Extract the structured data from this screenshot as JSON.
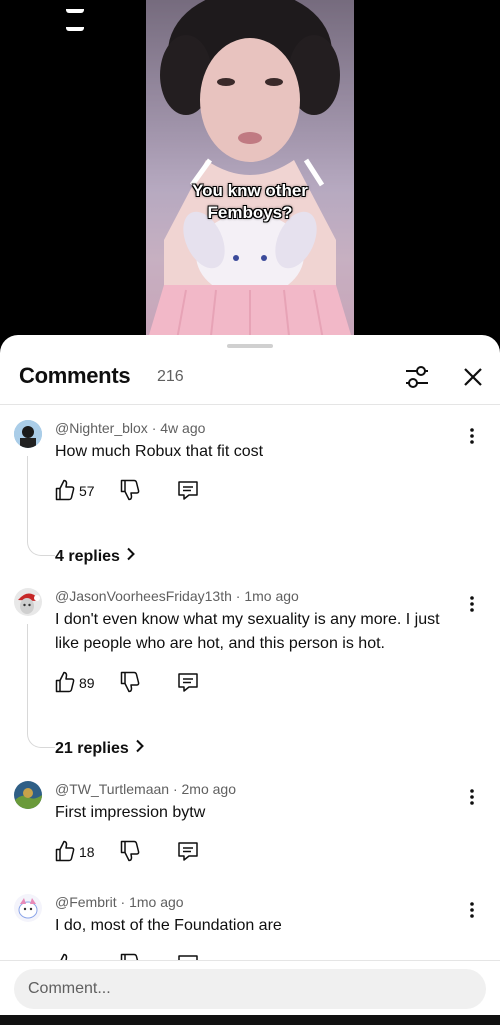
{
  "video": {
    "caption_line1": "You knw other",
    "caption_line2": "Femboys?"
  },
  "comments_sheet": {
    "title": "Comments",
    "count": "216",
    "filter_icon": "sliders-icon",
    "close_icon": "close-icon"
  },
  "comments": [
    {
      "author": "@Nighter_blox",
      "age": "4w ago",
      "meta": "@Nighter_blox · 4w ago",
      "text": "How much Robux that fit cost",
      "likes": "57",
      "replies": "4 replies"
    },
    {
      "author": "@JasonVoorheesFriday13th",
      "age": "1mo ago",
      "meta": "@JasonVoorheesFriday13th · 1mo ago",
      "text": "I don't even know what my sexuality is any more. I just like people who are hot, and this person is hot.",
      "likes": "89",
      "replies": "21 replies"
    },
    {
      "author": "@TW_Turtlemaan",
      "age": "2mo ago",
      "meta": "@TW_Turtlemaan · 2mo ago",
      "text": "First impression bytw",
      "likes": "18"
    },
    {
      "author": "@Fembrit",
      "age": "1mo ago",
      "meta": "@Fembrit · 1mo ago",
      "text": "I do, most of the Foundation are"
    }
  ],
  "input": {
    "placeholder": "Comment..."
  }
}
